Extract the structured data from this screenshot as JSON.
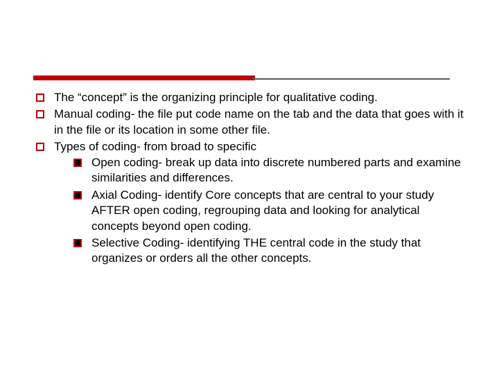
{
  "items": [
    {
      "text": "The “concept” is the organizing principle for qualitative coding."
    },
    {
      "text": "Manual coding- the file put code name on the tab and the data that goes with it in the file or its location in some other file."
    },
    {
      "text": "Types of coding- from broad to specific",
      "children": [
        {
          "text": "Open coding- break up data into discrete numbered parts and examine similarities and differences."
        },
        {
          "text": "Axial Coding- identify Core concepts that are central to your study AFTER open coding, regrouping data and looking for analytical concepts beyond open coding."
        },
        {
          "text": "Selective Coding- identifying THE central code in the study that organizes or orders all the other concepts."
        }
      ]
    }
  ]
}
